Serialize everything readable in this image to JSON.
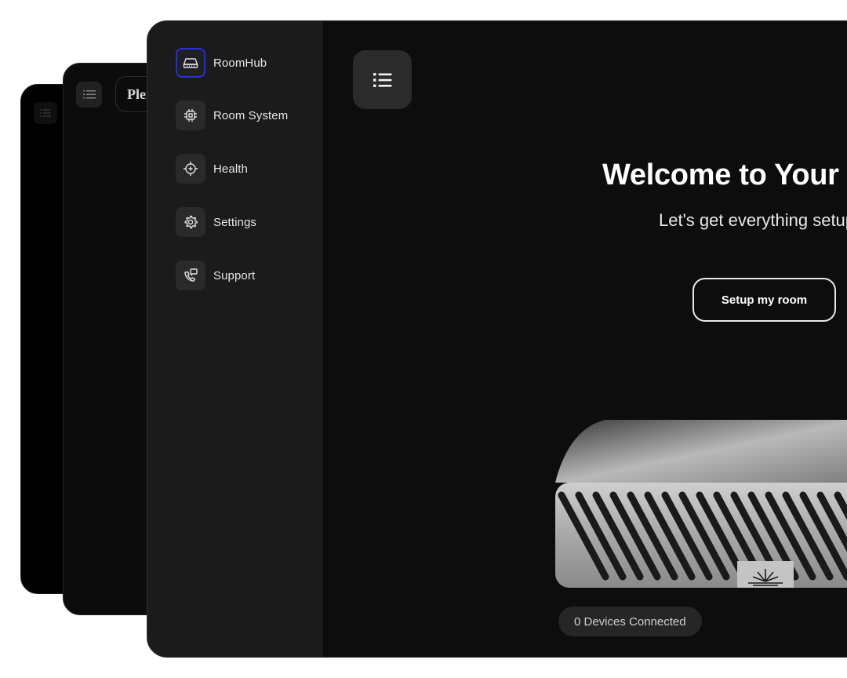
{
  "app": {
    "brand_fragment": "Plen"
  },
  "sidebar": {
    "items": [
      {
        "label": "RoomHub",
        "icon": "router-icon",
        "active": true
      },
      {
        "label": "Room System",
        "icon": "chip-icon",
        "active": false
      },
      {
        "label": "Health",
        "icon": "health-target-icon",
        "active": false
      },
      {
        "label": "Settings",
        "icon": "gear-icon",
        "active": false
      },
      {
        "label": "Support",
        "icon": "phone-chat-icon",
        "active": false
      }
    ]
  },
  "main": {
    "menu_icon": "list-icon",
    "welcome_title": "Welcome to Your Plenum",
    "subtitle": "Let's get everything setup",
    "setup_button_label": "Setup my room",
    "device_status": "0 Devices Connected"
  },
  "colors": {
    "active_outline": "#2430d6",
    "background": "#0d0d0d",
    "sidebar": "#1b1b1b"
  }
}
